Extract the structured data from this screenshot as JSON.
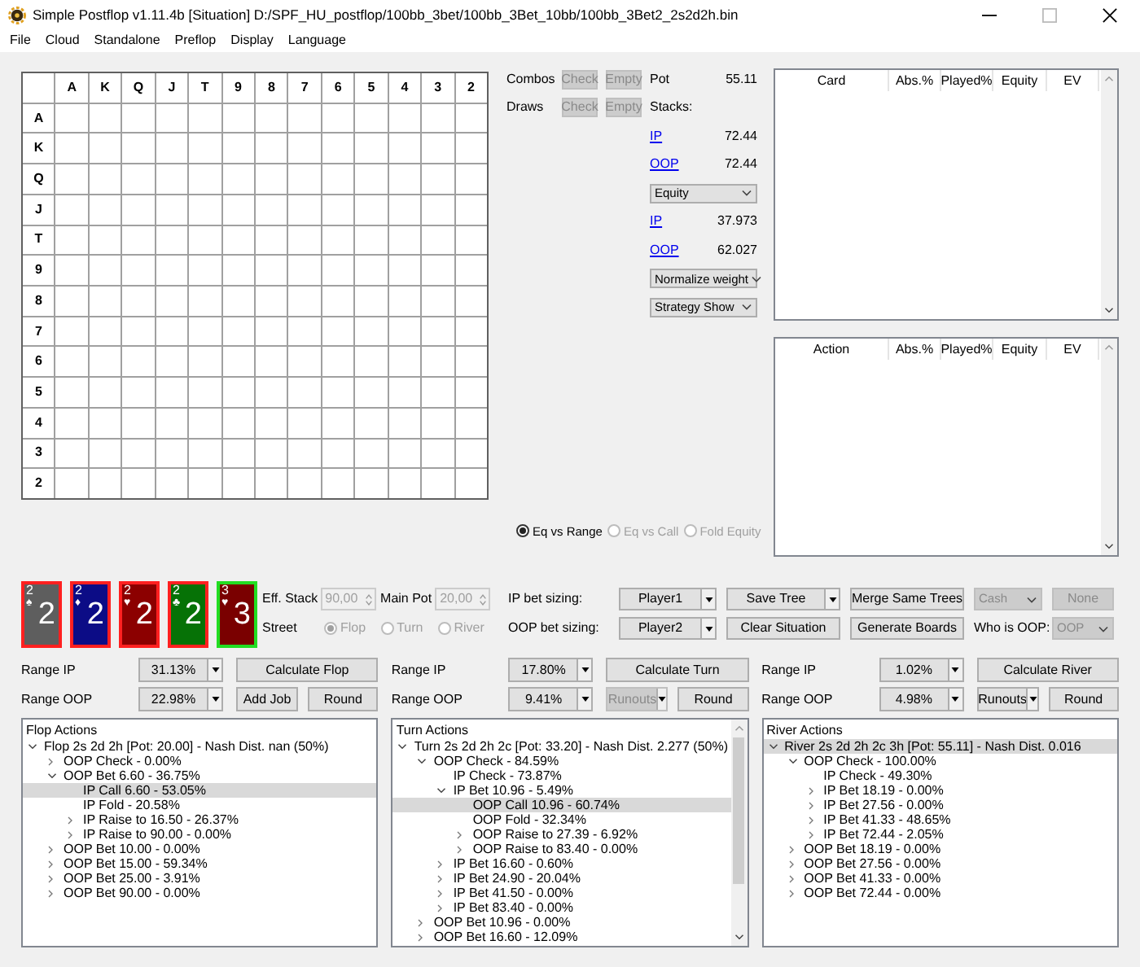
{
  "window": {
    "title": "Simple Postflop v1.11.4b [Situation] D:/SPF_HU_postflop/100bb_3bet/100bb_3Bet_10bb/100bb_3Bet2_2s2d2h.bin"
  },
  "menu": [
    "File",
    "Cloud",
    "Standalone",
    "Preflop",
    "Display",
    "Language"
  ],
  "matrix": {
    "column_headers": [
      "A",
      "K",
      "Q",
      "J",
      "T",
      "9",
      "8",
      "7",
      "6",
      "5",
      "4",
      "3",
      "2"
    ],
    "row_headers": [
      "A",
      "K",
      "Q",
      "J",
      "T",
      "9",
      "8",
      "7",
      "6",
      "5",
      "4",
      "3",
      "2"
    ]
  },
  "filters": [
    {
      "label": "Combos",
      "buttons": [
        {
          "label": "Check",
          "disabled": true
        },
        {
          "label": "Empty",
          "disabled": true
        }
      ]
    },
    {
      "label": "Draws",
      "buttons": [
        {
          "label": "Check",
          "disabled": true
        },
        {
          "label": "Empty",
          "disabled": true
        }
      ]
    }
  ],
  "pot": {
    "label": "Pot",
    "value": "55.11"
  },
  "stacks": {
    "label": "Stacks:",
    "rows": [
      {
        "player": "IP",
        "value": "72.44"
      },
      {
        "player": "OOP",
        "value": "72.44"
      }
    ]
  },
  "equity_select": "Equity",
  "equity_rows": [
    {
      "player": "IP",
      "value": "37.973"
    },
    {
      "player": "OOP",
      "value": "62.027"
    }
  ],
  "weight_select": "Normalize weight",
  "strategy_select": "Strategy Show",
  "equity_modes": [
    {
      "label": "Eq vs Range",
      "selected": true,
      "disabled": false
    },
    {
      "label": "Eq vs Call",
      "selected": false,
      "disabled": true
    },
    {
      "label": "Fold Equity",
      "selected": false,
      "disabled": true
    }
  ],
  "card_table": {
    "columns": [
      "Card",
      "Abs.%",
      "Played%",
      "Equity",
      "EV"
    ]
  },
  "action_table": {
    "columns": [
      "Action",
      "Abs.%",
      "Played%",
      "Equity",
      "EV"
    ]
  },
  "board": [
    {
      "corner": "2",
      "suit": "♠",
      "rank": "2",
      "color": "#5e5e5e",
      "selected": false
    },
    {
      "corner": "2",
      "suit": "♦",
      "rank": "2",
      "color": "#0c0c86",
      "selected": false
    },
    {
      "corner": "2",
      "suit": "♥",
      "rank": "2",
      "color": "#8c0000",
      "selected": false
    },
    {
      "corner": "2",
      "suit": "♣",
      "rank": "2",
      "color": "#067206",
      "selected": false
    },
    {
      "corner": "3",
      "suit": "♥",
      "rank": "3",
      "color": "#7a0000",
      "selected": true
    }
  ],
  "eff_stack": {
    "label": "Eff. Stack",
    "value": "90,00",
    "disabled": true
  },
  "main_pot": {
    "label": "Main Pot",
    "value": "20,00",
    "disabled": true
  },
  "street": {
    "label": "Street",
    "disabled": true,
    "options": [
      {
        "label": "Flop",
        "selected": true
      },
      {
        "label": "Turn",
        "selected": false
      },
      {
        "label": "River",
        "selected": false
      }
    ]
  },
  "toolbar_rows": [
    [
      {
        "kind": "label",
        "label": "IP bet sizing:"
      },
      {
        "kind": "combo",
        "label": "Player1",
        "disabled": false
      },
      {
        "kind": "combo",
        "label": "Save Tree",
        "disabled": false
      },
      {
        "kind": "button",
        "label": "Merge Same Trees",
        "disabled": false
      },
      {
        "kind": "select",
        "label": "Cash",
        "disabled": true
      },
      {
        "kind": "button",
        "label": "None",
        "disabled": true
      }
    ],
    [
      {
        "kind": "label",
        "label": "OOP bet sizing:"
      },
      {
        "kind": "combo",
        "label": "Player2",
        "disabled": false
      },
      {
        "kind": "button",
        "label": "Clear Situation",
        "disabled": false
      },
      {
        "kind": "button",
        "label": "Generate Boards",
        "disabled": false
      },
      {
        "kind": "label",
        "label": "Who is OOP:"
      },
      {
        "kind": "select",
        "label": "OOP",
        "disabled": true
      }
    ]
  ],
  "streets": [
    {
      "range_ip_label": "Range IP",
      "range_ip": "31.13%",
      "calculate": "Calculate Flop",
      "range_oop_label": "Range OOP",
      "range_oop": "22.98%",
      "extras": [
        {
          "kind": "button",
          "label": "Add Job",
          "disabled": false
        },
        {
          "kind": "button",
          "label": "Round",
          "disabled": false
        }
      ],
      "tree": {
        "title": "Flop Actions",
        "scrollbar": false,
        "nodes": [
          {
            "text": "Flop 2s 2d 2h [Pot: 20.00] - Nash Dist. nan (50%)",
            "kind": "branch",
            "expanded": true,
            "selected": false,
            "children": [
              {
                "text": "OOP Check - 0.00%",
                "kind": "branch",
                "expanded": false,
                "selected": false
              },
              {
                "text": "OOP Bet 6.60 - 36.75%",
                "kind": "branch",
                "expanded": true,
                "selected": false,
                "children": [
                  {
                    "text": "IP Call 6.60 - 53.05%",
                    "kind": "leaf",
                    "selected": true
                  },
                  {
                    "text": "IP Fold - 20.58%",
                    "kind": "leaf",
                    "selected": false
                  },
                  {
                    "text": "IP Raise to 16.50 - 26.37%",
                    "kind": "branch",
                    "expanded": false,
                    "selected": false
                  },
                  {
                    "text": "IP Raise to 90.00 - 0.00%",
                    "kind": "branch",
                    "expanded": false,
                    "selected": false
                  }
                ]
              },
              {
                "text": "OOP Bet 10.00 - 0.00%",
                "kind": "branch",
                "expanded": false,
                "selected": false
              },
              {
                "text": "OOP Bet 15.00 - 59.34%",
                "kind": "branch",
                "expanded": false,
                "selected": false
              },
              {
                "text": "OOP Bet 25.00 - 3.91%",
                "kind": "branch",
                "expanded": false,
                "selected": false
              },
              {
                "text": "OOP Bet 90.00 - 0.00%",
                "kind": "branch",
                "expanded": false,
                "selected": false
              }
            ]
          }
        ]
      }
    },
    {
      "range_ip_label": "Range IP",
      "range_ip": "17.80%",
      "calculate": "Calculate Turn",
      "range_oop_label": "Range OOP",
      "range_oop": "9.41%",
      "extras": [
        {
          "kind": "combo",
          "label": "Runouts",
          "disabled": true
        },
        {
          "kind": "button",
          "label": "Round",
          "disabled": false
        }
      ],
      "tree": {
        "title": "Turn Actions",
        "scrollbar": true,
        "nodes": [
          {
            "text": "Turn 2s 2d 2h 2c [Pot: 33.20] - Nash Dist. 2.277 (50%)",
            "kind": "branch",
            "expanded": true,
            "selected": false,
            "children": [
              {
                "text": "OOP Check - 84.59%",
                "kind": "branch",
                "expanded": true,
                "selected": false,
                "children": [
                  {
                    "text": "IP Check - 73.87%",
                    "kind": "leaf",
                    "selected": false
                  },
                  {
                    "text": "IP Bet 10.96 - 5.49%",
                    "kind": "branch",
                    "expanded": true,
                    "selected": false,
                    "children": [
                      {
                        "text": "OOP Call 10.96 - 60.74%",
                        "kind": "leaf",
                        "selected": true
                      },
                      {
                        "text": "OOP Fold - 32.34%",
                        "kind": "leaf",
                        "selected": false
                      },
                      {
                        "text": "OOP Raise to 27.39 - 6.92%",
                        "kind": "branch",
                        "expanded": false,
                        "selected": false
                      },
                      {
                        "text": "OOP Raise to 83.40 - 0.00%",
                        "kind": "branch",
                        "expanded": false,
                        "selected": false
                      }
                    ]
                  },
                  {
                    "text": "IP Bet 16.60 - 0.60%",
                    "kind": "branch",
                    "expanded": false,
                    "selected": false
                  },
                  {
                    "text": "IP Bet 24.90 - 20.04%",
                    "kind": "branch",
                    "expanded": false,
                    "selected": false
                  },
                  {
                    "text": "IP Bet 41.50 - 0.00%",
                    "kind": "branch",
                    "expanded": false,
                    "selected": false
                  },
                  {
                    "text": "IP Bet 83.40 - 0.00%",
                    "kind": "branch",
                    "expanded": false,
                    "selected": false
                  }
                ]
              },
              {
                "text": "OOP Bet 10.96 - 0.00%",
                "kind": "branch",
                "expanded": false,
                "selected": false
              },
              {
                "text": "OOP Bet 16.60 - 12.09%",
                "kind": "branch",
                "expanded": false,
                "selected": false
              }
            ]
          }
        ]
      }
    },
    {
      "range_ip_label": "Range IP",
      "range_ip": "1.02%",
      "calculate": "Calculate River",
      "range_oop_label": "Range OOP",
      "range_oop": "4.98%",
      "extras": [
        {
          "kind": "combo",
          "label": "Runouts",
          "disabled": false
        },
        {
          "kind": "button",
          "label": "Round",
          "disabled": false
        }
      ],
      "tree": {
        "title": "River Actions",
        "scrollbar": false,
        "nodes": [
          {
            "text": "River 2s 2d 2h 2c 3h [Pot: 55.11] - Nash Dist. 0.016",
            "kind": "branch",
            "expanded": true,
            "selected": true,
            "children": [
              {
                "text": "OOP Check - 100.00%",
                "kind": "branch",
                "expanded": true,
                "selected": false,
                "children": [
                  {
                    "text": "IP Check - 49.30%",
                    "kind": "leaf",
                    "selected": false
                  },
                  {
                    "text": "IP Bet 18.19 - 0.00%",
                    "kind": "branch",
                    "expanded": false,
                    "selected": false
                  },
                  {
                    "text": "IP Bet 27.56 - 0.00%",
                    "kind": "branch",
                    "expanded": false,
                    "selected": false
                  },
                  {
                    "text": "IP Bet 41.33 - 48.65%",
                    "kind": "branch",
                    "expanded": false,
                    "selected": false
                  },
                  {
                    "text": "IP Bet 72.44 - 2.05%",
                    "kind": "branch",
                    "expanded": false,
                    "selected": false
                  }
                ]
              },
              {
                "text": "OOP Bet 18.19 - 0.00%",
                "kind": "branch",
                "expanded": false,
                "selected": false
              },
              {
                "text": "OOP Bet 27.56 - 0.00%",
                "kind": "branch",
                "expanded": false,
                "selected": false
              },
              {
                "text": "OOP Bet 41.33 - 0.00%",
                "kind": "branch",
                "expanded": false,
                "selected": false
              },
              {
                "text": "OOP Bet 72.44 - 0.00%",
                "kind": "branch",
                "expanded": false,
                "selected": false
              }
            ]
          }
        ]
      }
    }
  ]
}
